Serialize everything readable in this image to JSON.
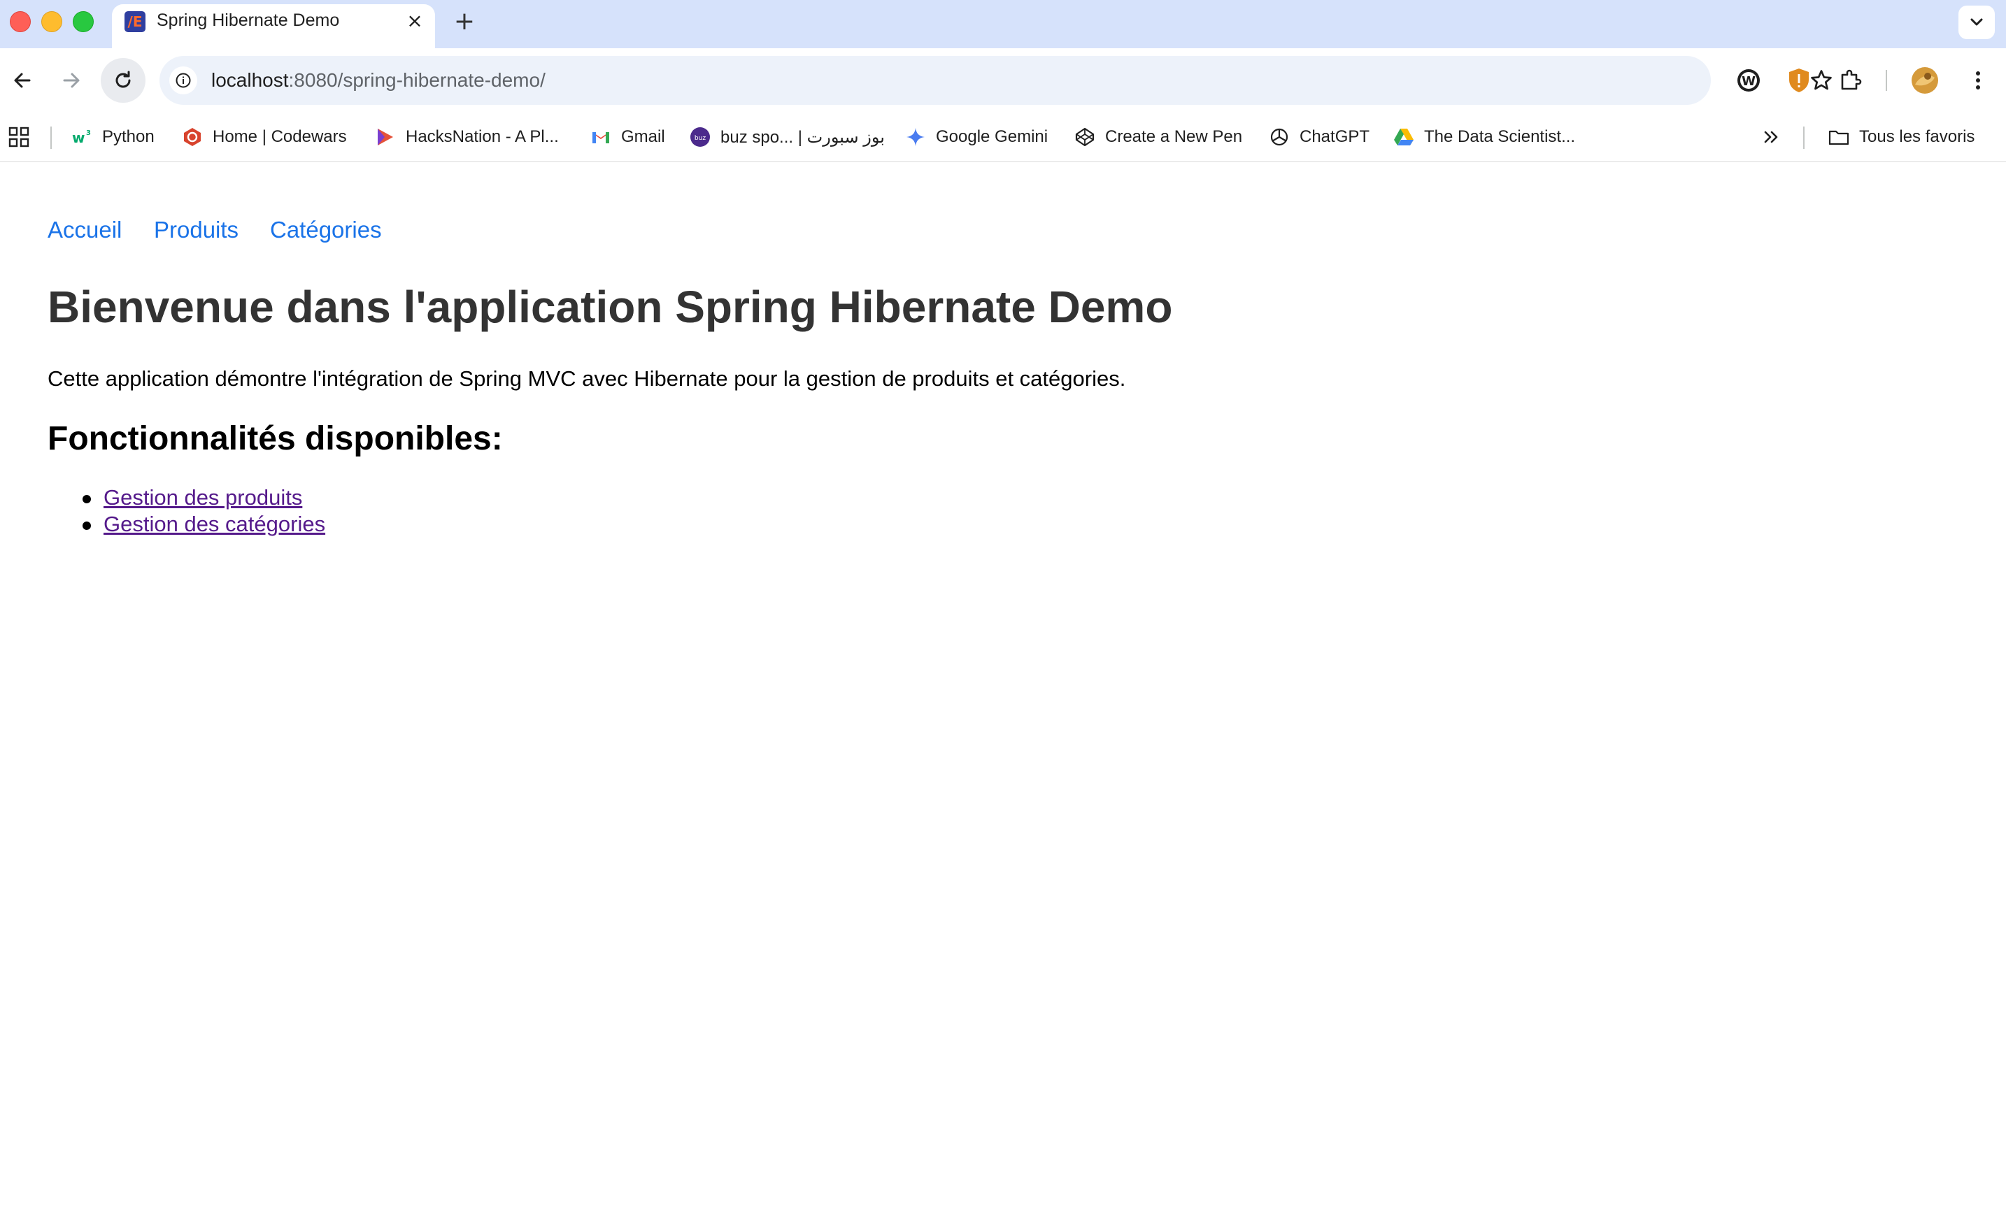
{
  "browser": {
    "tab": {
      "title": "Spring Hibernate Demo",
      "favicon_text": "/E"
    },
    "url": {
      "host": "localhost",
      "path": ":8080/spring-hibernate-demo/"
    },
    "bookmarks": [
      {
        "label": "Python",
        "icon": "w3schools-icon"
      },
      {
        "label": "Home | Codewars",
        "icon": "codewars-icon"
      },
      {
        "label": "HacksNation - A Pl...",
        "icon": "hacksnation-icon"
      },
      {
        "label": "Gmail",
        "icon": "gmail-icon"
      },
      {
        "label": "buz spo... | بوز سبورت",
        "icon": "buz-icon"
      },
      {
        "label": "Google Gemini",
        "icon": "gemini-icon"
      },
      {
        "label": "Create a New Pen",
        "icon": "codepen-icon"
      },
      {
        "label": "ChatGPT",
        "icon": "chatgpt-icon"
      },
      {
        "label": "The Data Scientist...",
        "icon": "google-drive-icon"
      }
    ],
    "all_bookmarks_label": "Tous les favoris"
  },
  "page": {
    "nav": [
      "Accueil",
      "Produits",
      "Catégories"
    ],
    "heading": "Bienvenue dans l'application Spring Hibernate Demo",
    "intro": "Cette application démontre l'intégration de Spring MVC avec Hibernate pour la gestion de produits et catégories.",
    "features_title": "Fonctionnalités disponibles:",
    "features": [
      "Gestion des produits",
      "Gestion des catégories"
    ]
  },
  "colors": {
    "link": "#1a73e8",
    "visited_link": "#551a8b",
    "heading": "#333333",
    "tabstrip": "#d6e2fb"
  }
}
